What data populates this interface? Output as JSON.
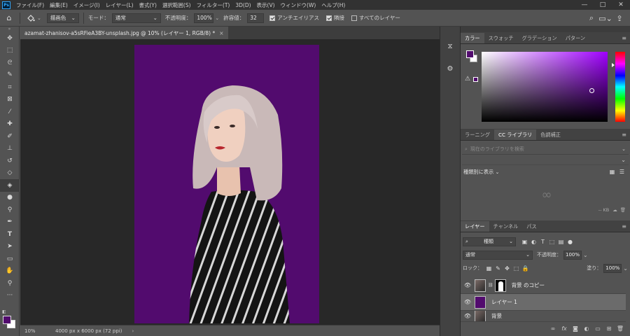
{
  "menu": {
    "items": [
      "ファイル(F)",
      "編集(E)",
      "イメージ(I)",
      "レイヤー(L)",
      "書式(Y)",
      "選択範囲(S)",
      "フィルター(T)",
      "3D(D)",
      "表示(V)",
      "ウィンドウ(W)",
      "ヘルプ(H)"
    ],
    "app_logo": "Ps"
  },
  "options": {
    "fill_source": "描画色",
    "mode_label": "モード：",
    "mode_value": "通常",
    "opacity_label": "不透明度：",
    "opacity_value": "100%",
    "tolerance_label": "許容値：",
    "tolerance_value": "32",
    "antialias_label": "アンチエイリアス",
    "contiguous_label": "隣接",
    "all_layers_label": "すべてのレイヤー"
  },
  "document": {
    "tab_title": "azamat-zhanisov-a5sRFieA3BY-unsplash.jpg @ 10% (レイヤー 1, RGB/8) *",
    "zoom": "10%",
    "doc_info": "4000 px x 6000 px (72 ppi)"
  },
  "color_panel": {
    "tabs": [
      "カラー",
      "スウォッチ",
      "グラデーション",
      "パターン"
    ],
    "foreground": "#520b6e",
    "background": "#ffffff"
  },
  "library_panel": {
    "tabs": [
      "ラーニング",
      "CC ライブラリ",
      "色調補正"
    ],
    "search_placeholder": "現在のライブラリを検索",
    "view_by": "種類別に表示",
    "size": "-- KB"
  },
  "layers_panel": {
    "tabs": [
      "レイヤー",
      "チャンネル",
      "パス"
    ],
    "kind_filter": "種類",
    "blend_mode": "通常",
    "opacity_label": "不透明度：",
    "opacity_value": "100%",
    "lock_label": "ロック：",
    "fill_label": "塗り：",
    "fill_value": "100%",
    "layers": [
      {
        "name": "背景 のコピー"
      },
      {
        "name": "レイヤー 1"
      },
      {
        "name": "背景"
      }
    ]
  },
  "colors": {
    "fill_purple": "#520b6e"
  }
}
